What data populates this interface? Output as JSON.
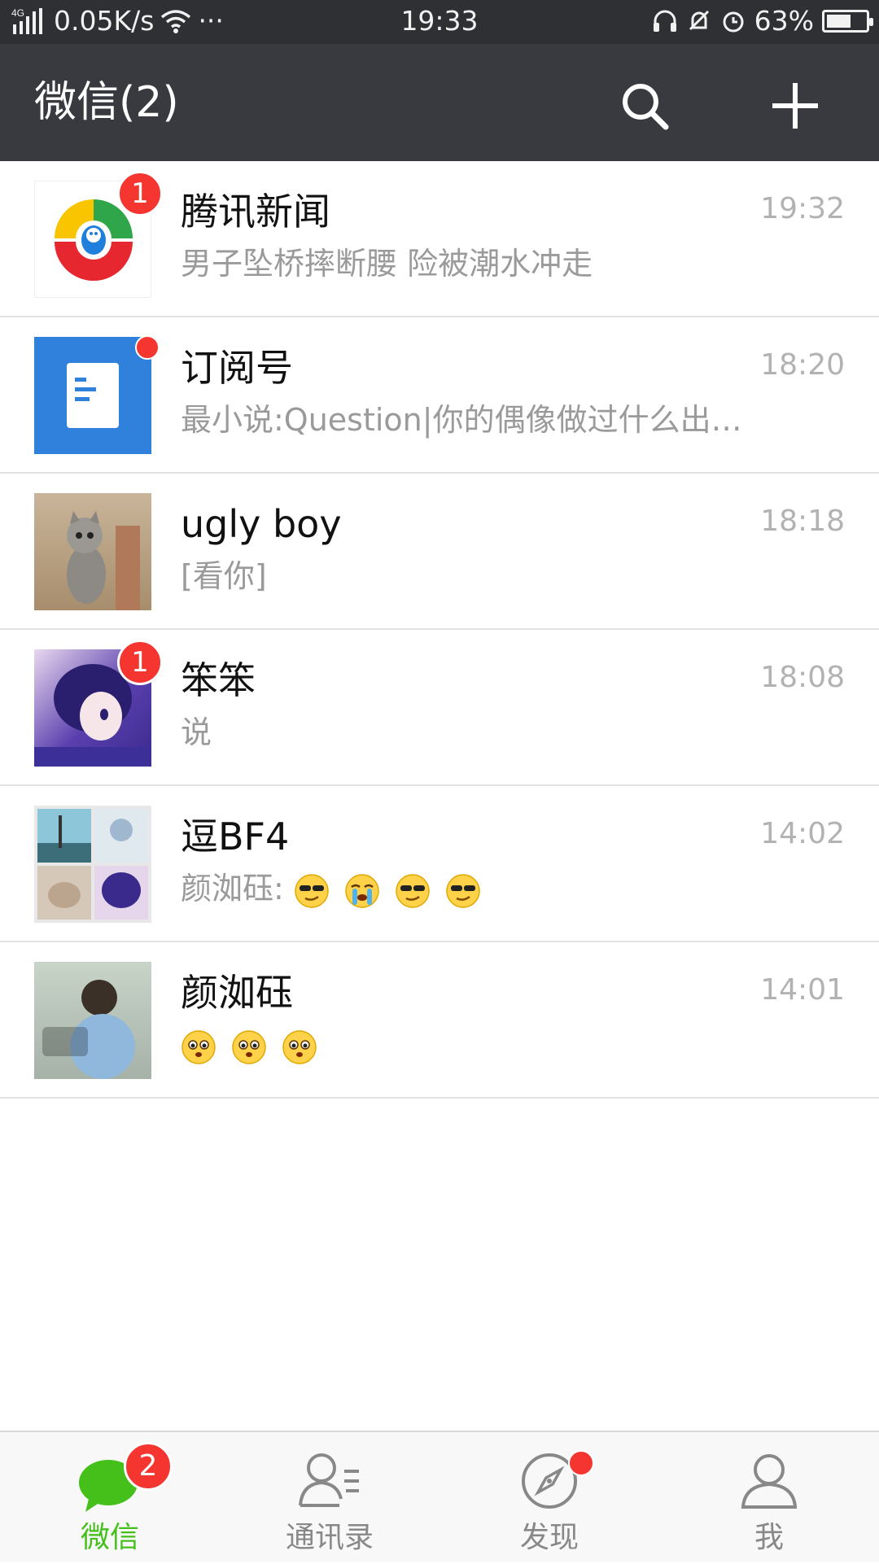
{
  "status_bar": {
    "network": "4G",
    "speed": "0.05K/s",
    "more": "···",
    "time": "19:33",
    "battery": "63%",
    "battery_level": 0.63
  },
  "header": {
    "title": "微信(2)",
    "search_icon": "search-icon",
    "add_icon": "plus-icon"
  },
  "chats": [
    {
      "name": "腾讯新闻",
      "preview": "男子坠桥摔断腰 险被潮水冲走",
      "time": "19:32",
      "badge": "1"
    },
    {
      "name": "订阅号",
      "preview": "最小说:Question|你的偶像做过什么出…",
      "time": "18:20",
      "badge_dot": true
    },
    {
      "name": "ugly boy",
      "preview": "[看你]",
      "time": "18:18"
    },
    {
      "name": "笨笨",
      "preview": "说",
      "time": "18:08",
      "badge": "1"
    },
    {
      "name": "逗BF4",
      "preview": "颜洳砡:",
      "time": "14:02",
      "emoji": [
        "cool-emoji",
        "crying-emoji",
        "cool-emoji",
        "cool-emoji"
      ]
    },
    {
      "name": "颜洳砡",
      "preview": "",
      "time": "14:01",
      "emoji": [
        "pleading-emoji",
        "pleading-emoji",
        "pleading-emoji"
      ]
    }
  ],
  "tabs": [
    {
      "label": "微信",
      "badge": "2",
      "icon": "chat-bubble-icon",
      "active": true
    },
    {
      "label": "通讯录",
      "icon": "contacts-icon"
    },
    {
      "label": "发现",
      "icon": "compass-icon",
      "dot": true
    },
    {
      "label": "我",
      "icon": "person-icon"
    }
  ],
  "colors": {
    "header_bg": "#393a3f",
    "status_bg": "#2f3033",
    "accent_green": "#45c01a",
    "badge_red": "#f43530"
  }
}
